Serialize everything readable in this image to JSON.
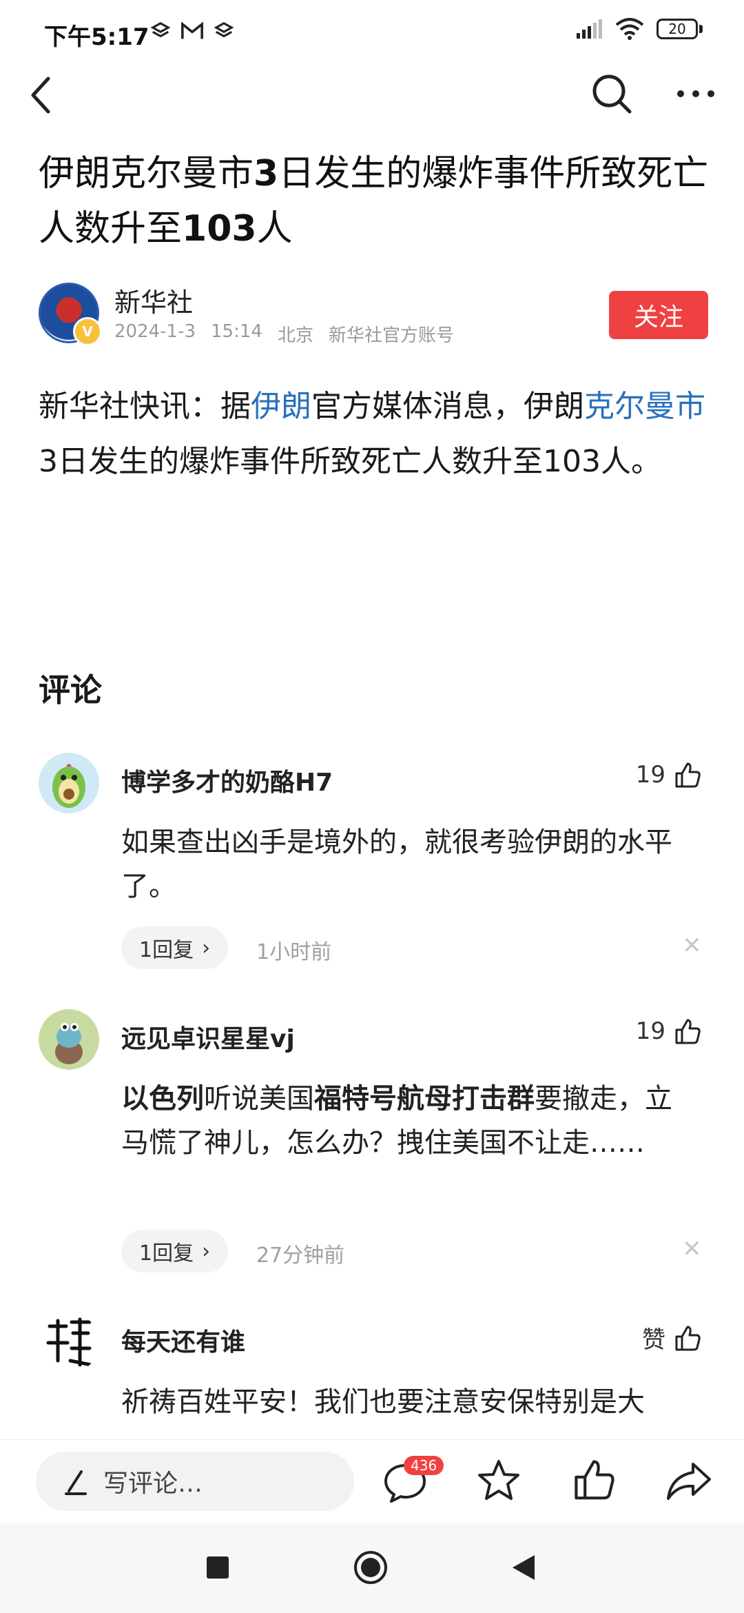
{
  "status_bar": {
    "time": "下午5:17",
    "battery": "20",
    "left_icons": [
      "layers-icon",
      "gmail-icon",
      "layers-icon"
    ],
    "right_icons": [
      "signal-icon",
      "wifi-icon",
      "battery-icon"
    ]
  },
  "top_nav": {
    "back_icon": "chevron-left-icon",
    "search_icon": "search-icon",
    "more_icon": "more-icon"
  },
  "article": {
    "title_parts": [
      "伊朗克尔曼市",
      "3",
      "日发生的爆炸事件所致死亡人数升至",
      "103",
      "人"
    ],
    "author": {
      "name": "新华社",
      "date": "2024-1-3",
      "time": "15:14",
      "location": "北京",
      "account_type": "新华社官方账号",
      "verified_mark": "V"
    },
    "follow_label": "关注",
    "body_parts": [
      "新华社快讯：据",
      "伊朗",
      "官方媒体消息，伊朗",
      "克尔曼市",
      "3日发生的爆炸事件所致死亡人数升至103人。"
    ]
  },
  "comments": {
    "heading": "评论",
    "items": [
      {
        "user": "博学多才的奶酪H7",
        "likes": "19",
        "text": "如果查出凶手是境外的，就很考验伊朗的水平了。",
        "replies": "1回复",
        "time": "1小时前"
      },
      {
        "user": "远见卓识星星vj",
        "likes": "19",
        "text_parts": [
          "以色列",
          "听说美国",
          "福特号航母打击群",
          "要撤走，立马慌了神儿，怎么办？拽住美国不让走……"
        ],
        "replies": "1回复",
        "time": "27分钟前"
      },
      {
        "user": "每天还有谁",
        "likes": "赞",
        "text": "祈祷百姓平安！我们也要注意安保特别是大"
      }
    ]
  },
  "bottom_bar": {
    "comment_placeholder": "写评论…",
    "comment_count": "436",
    "icons": [
      "comment-icon",
      "star-icon",
      "thumbs-up-icon",
      "share-icon"
    ]
  },
  "nav_bar": {
    "icons": [
      "recents-icon",
      "home-icon",
      "back-icon"
    ]
  },
  "colors": {
    "accent_red": "#f04142",
    "link_blue": "#2a6fbd"
  }
}
